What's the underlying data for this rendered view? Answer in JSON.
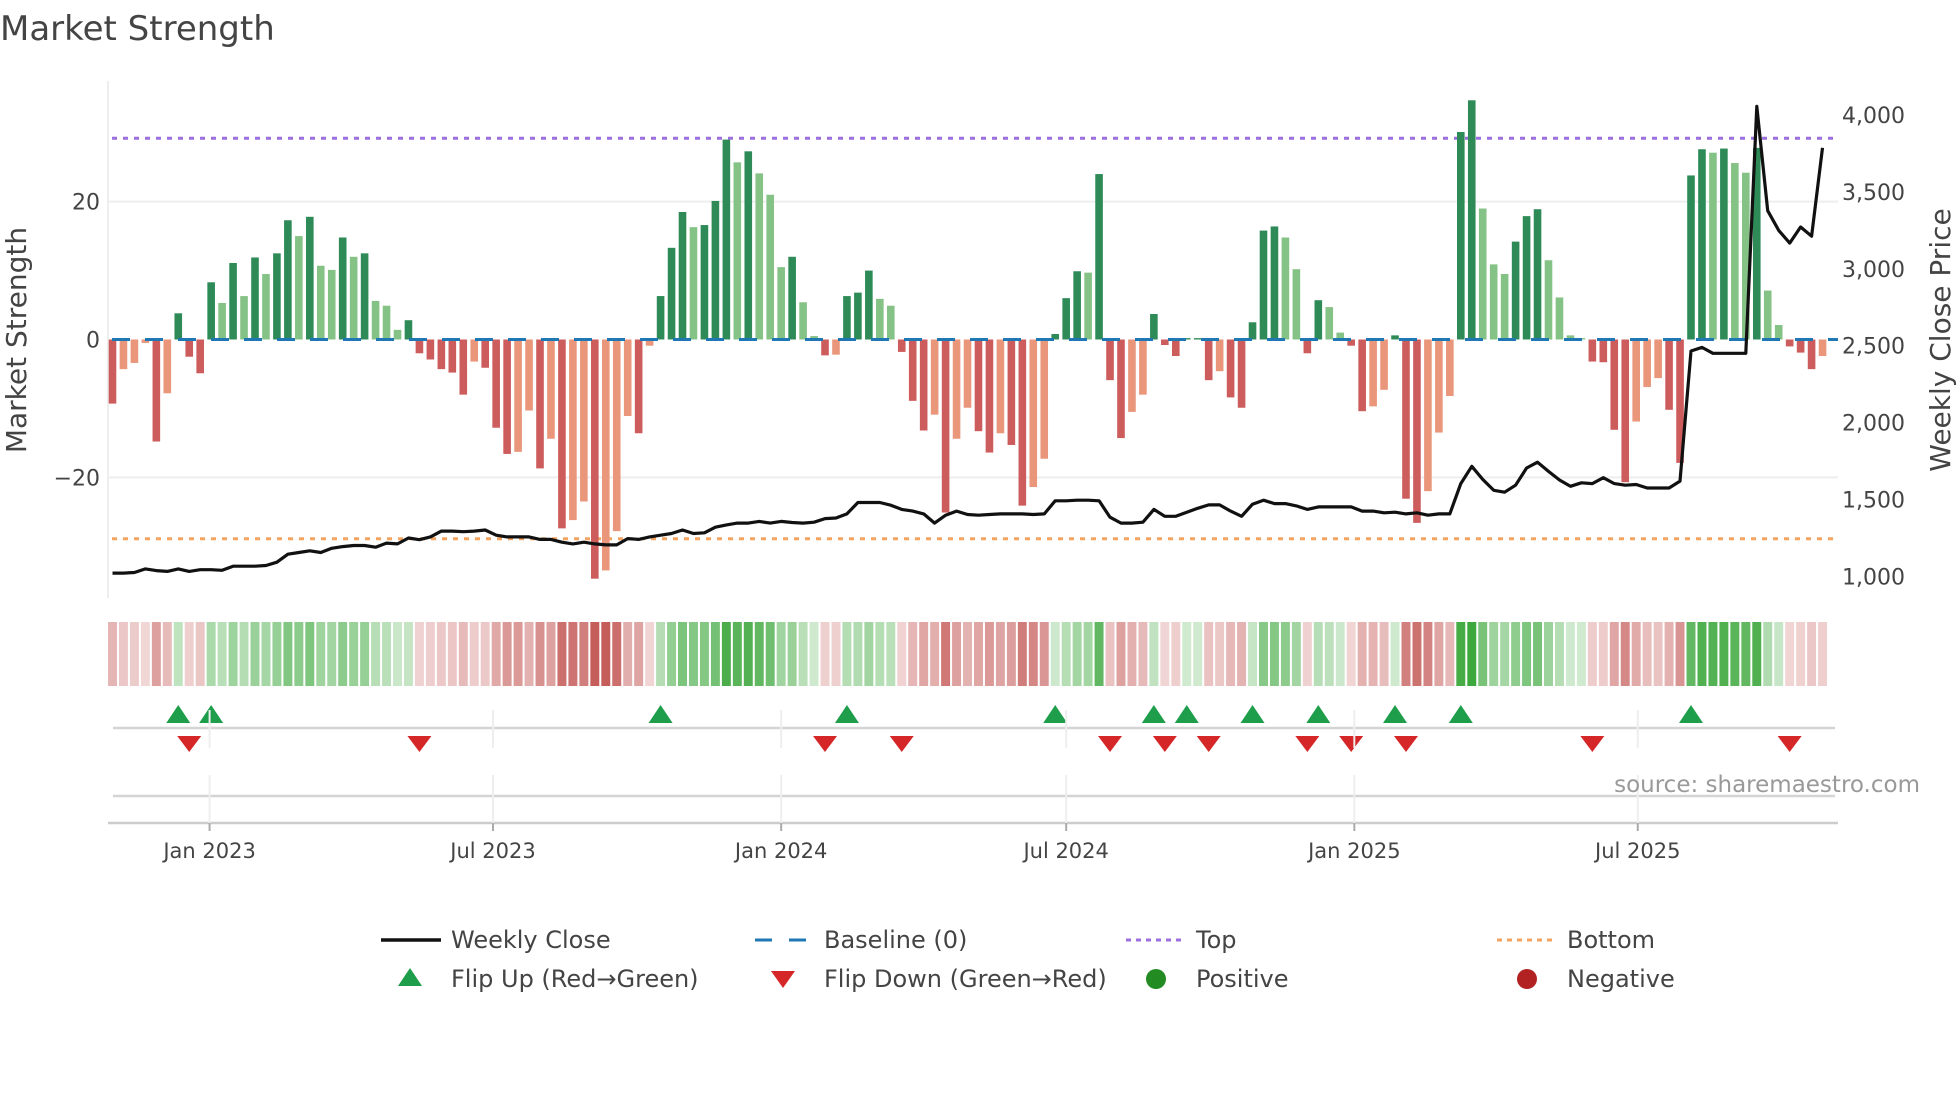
{
  "title": "Market Strength",
  "source": "source: sharemaestro.com",
  "chart_data": {
    "type": "bar",
    "title": "Market Strength",
    "ylabel": "Market Strength",
    "y2label": "Weekly Close Price",
    "frequency": "weekly",
    "start_date": "2022-10-31",
    "ylim": [
      -37.5,
      37.5
    ],
    "y_ticks": [
      {
        "value": 20,
        "label": "20"
      },
      {
        "value": 0,
        "label": "0"
      },
      {
        "value": -20,
        "label": "−20"
      }
    ],
    "y2lim": [
      860,
      4221
    ],
    "y2_ticks": [
      {
        "value": 4000,
        "label": "4,000"
      },
      {
        "value": 3500,
        "label": "3,500"
      },
      {
        "value": 3000,
        "label": "3,000"
      },
      {
        "value": 2500,
        "label": "2,500"
      },
      {
        "value": 2000,
        "label": "2,000"
      },
      {
        "value": 1500,
        "label": "1,500"
      },
      {
        "value": 1000,
        "label": "1,000"
      }
    ],
    "x_ticks": [
      {
        "date": "2023-01-01",
        "label": "Jan 2023"
      },
      {
        "date": "2023-07-01",
        "label": "Jul 2023"
      },
      {
        "date": "2024-01-01",
        "label": "Jan 2024"
      },
      {
        "date": "2024-07-01",
        "label": "Jul 2024"
      },
      {
        "date": "2025-01-01",
        "label": "Jan 2025"
      },
      {
        "date": "2025-07-01",
        "label": "Jul 2025"
      }
    ],
    "grid": true,
    "top_level": 29.2,
    "bottom_level": -28.9,
    "baseline": 0,
    "strength": [
      -9.3,
      -4.3,
      -3.4,
      -0.5,
      -14.8,
      -7.8,
      3.8,
      -2.5,
      -4.9,
      8.3,
      5.3,
      11.1,
      6.3,
      11.9,
      9.5,
      12.5,
      17.3,
      15,
      17.8,
      10.7,
      10.1,
      14.8,
      12,
      12.5,
      5.6,
      4.9,
      1.4,
      2.8,
      -2,
      -2.9,
      -4.3,
      -4.8,
      -8,
      -3.2,
      -4.1,
      -12.8,
      -16.6,
      -16.3,
      -10.3,
      -18.7,
      -14.4,
      -27.4,
      -26.2,
      -23.5,
      -34.7,
      -33.5,
      -27.8,
      -11.1,
      -13.6,
      -0.9,
      6.3,
      13.3,
      18.5,
      16.3,
      16.6,
      20.1,
      29,
      25.7,
      27.3,
      24.1,
      21,
      10.5,
      12,
      5.4,
      0.5,
      -2.3,
      -2.2,
      6.3,
      6.8,
      10,
      5.9,
      4.9,
      -1.8,
      -8.9,
      -13.2,
      -10.9,
      -25.1,
      -14.4,
      -9.9,
      -13.3,
      -16.4,
      -13.6,
      -15.3,
      -24.1,
      -21.4,
      -17.3,
      0.8,
      6,
      9.9,
      9.7,
      24,
      -5.9,
      -14.3,
      -10.5,
      -8,
      3.7,
      -0.8,
      -2.4,
      0.2,
      0.2,
      -5.9,
      -4.6,
      -8.4,
      -9.9,
      2.5,
      15.8,
      16.4,
      14.8,
      10.2,
      -2,
      5.7,
      4.7,
      1,
      -0.9,
      -10.4,
      -9.7,
      -7.3,
      0.6,
      -23.1,
      -26.6,
      -22,
      -13.5,
      -8.2,
      30.1,
      34.7,
      19,
      10.9,
      9.5,
      14.2,
      17.9,
      18.9,
      11.5,
      6.1,
      0.6,
      0.2,
      -3.2,
      -3.3,
      -13.1,
      -20.7,
      -11.9,
      -6.9,
      -5.6,
      -10.2,
      -17.9,
      23.8,
      27.6,
      27.1,
      27.7,
      25.6,
      24.2,
      27.8,
      7.1,
      2.1,
      -1,
      -1.9,
      -4.3,
      -2.4
    ],
    "weekly_close": [
      1022,
      1022,
      1026,
      1049,
      1038,
      1033,
      1049,
      1033,
      1044,
      1044,
      1040,
      1067,
      1067,
      1067,
      1071,
      1093,
      1145,
      1156,
      1167,
      1156,
      1183,
      1194,
      1201,
      1201,
      1190,
      1217,
      1212,
      1250,
      1239,
      1257,
      1295,
      1295,
      1291,
      1295,
      1302,
      1268,
      1257,
      1257,
      1257,
      1241,
      1241,
      1223,
      1212,
      1223,
      1212,
      1205,
      1205,
      1246,
      1241,
      1257,
      1268,
      1279,
      1302,
      1279,
      1284,
      1320,
      1335,
      1347,
      1347,
      1358,
      1347,
      1358,
      1351,
      1347,
      1353,
      1376,
      1380,
      1407,
      1481,
      1481,
      1481,
      1463,
      1436,
      1425,
      1407,
      1347,
      1398,
      1425,
      1403,
      1398,
      1403,
      1407,
      1407,
      1407,
      1403,
      1407,
      1492,
      1492,
      1496,
      1496,
      1492,
      1385,
      1347,
      1347,
      1353,
      1436,
      1391,
      1391,
      1418,
      1443,
      1465,
      1465,
      1425,
      1391,
      1470,
      1496,
      1474,
      1474,
      1459,
      1436,
      1452,
      1452,
      1452,
      1452,
      1425,
      1425,
      1414,
      1418,
      1407,
      1414,
      1398,
      1407,
      1407,
      1604,
      1716,
      1631,
      1560,
      1548,
      1593,
      1705,
      1743,
      1683,
      1627,
      1586,
      1609,
      1604,
      1642,
      1604,
      1593,
      1598,
      1575,
      1575,
      1575,
      1620,
      2466,
      2489,
      2451,
      2451,
      2451,
      2451,
      4056,
      3378,
      3250,
      3167,
      3272,
      3212,
      3787
    ],
    "legend": [
      {
        "label": "Weekly Close",
        "kind": "line"
      },
      {
        "label": "Baseline (0)",
        "kind": "dash"
      },
      {
        "label": "Top",
        "kind": "dot-top"
      },
      {
        "label": "Bottom",
        "kind": "dot-bottom"
      },
      {
        "label": "Flip Up (Red→Green)",
        "kind": "tri-up"
      },
      {
        "label": "Flip Down (Green→Red)",
        "kind": "tri-down"
      },
      {
        "label": "Positive",
        "kind": "dot-pos"
      },
      {
        "label": "Negative",
        "kind": "dot-neg"
      }
    ],
    "legend_placement": "bottom",
    "colors": {
      "pos_strong": "#2e8b57",
      "pos_weak": "#85c285",
      "neg_strong": "#cd5c5c",
      "neg_weak": "#e9967a",
      "line": "#111111",
      "baseline": "#1f77b4",
      "top": "#9b6fe0",
      "bottom": "#f4a460",
      "flip_up": "#1e9e4a",
      "flip_down": "#d62728",
      "positive": "#228b22",
      "negative": "#b22222",
      "heat_pos": "#2ca02c",
      "heat_neg": "#c0504d"
    }
  }
}
